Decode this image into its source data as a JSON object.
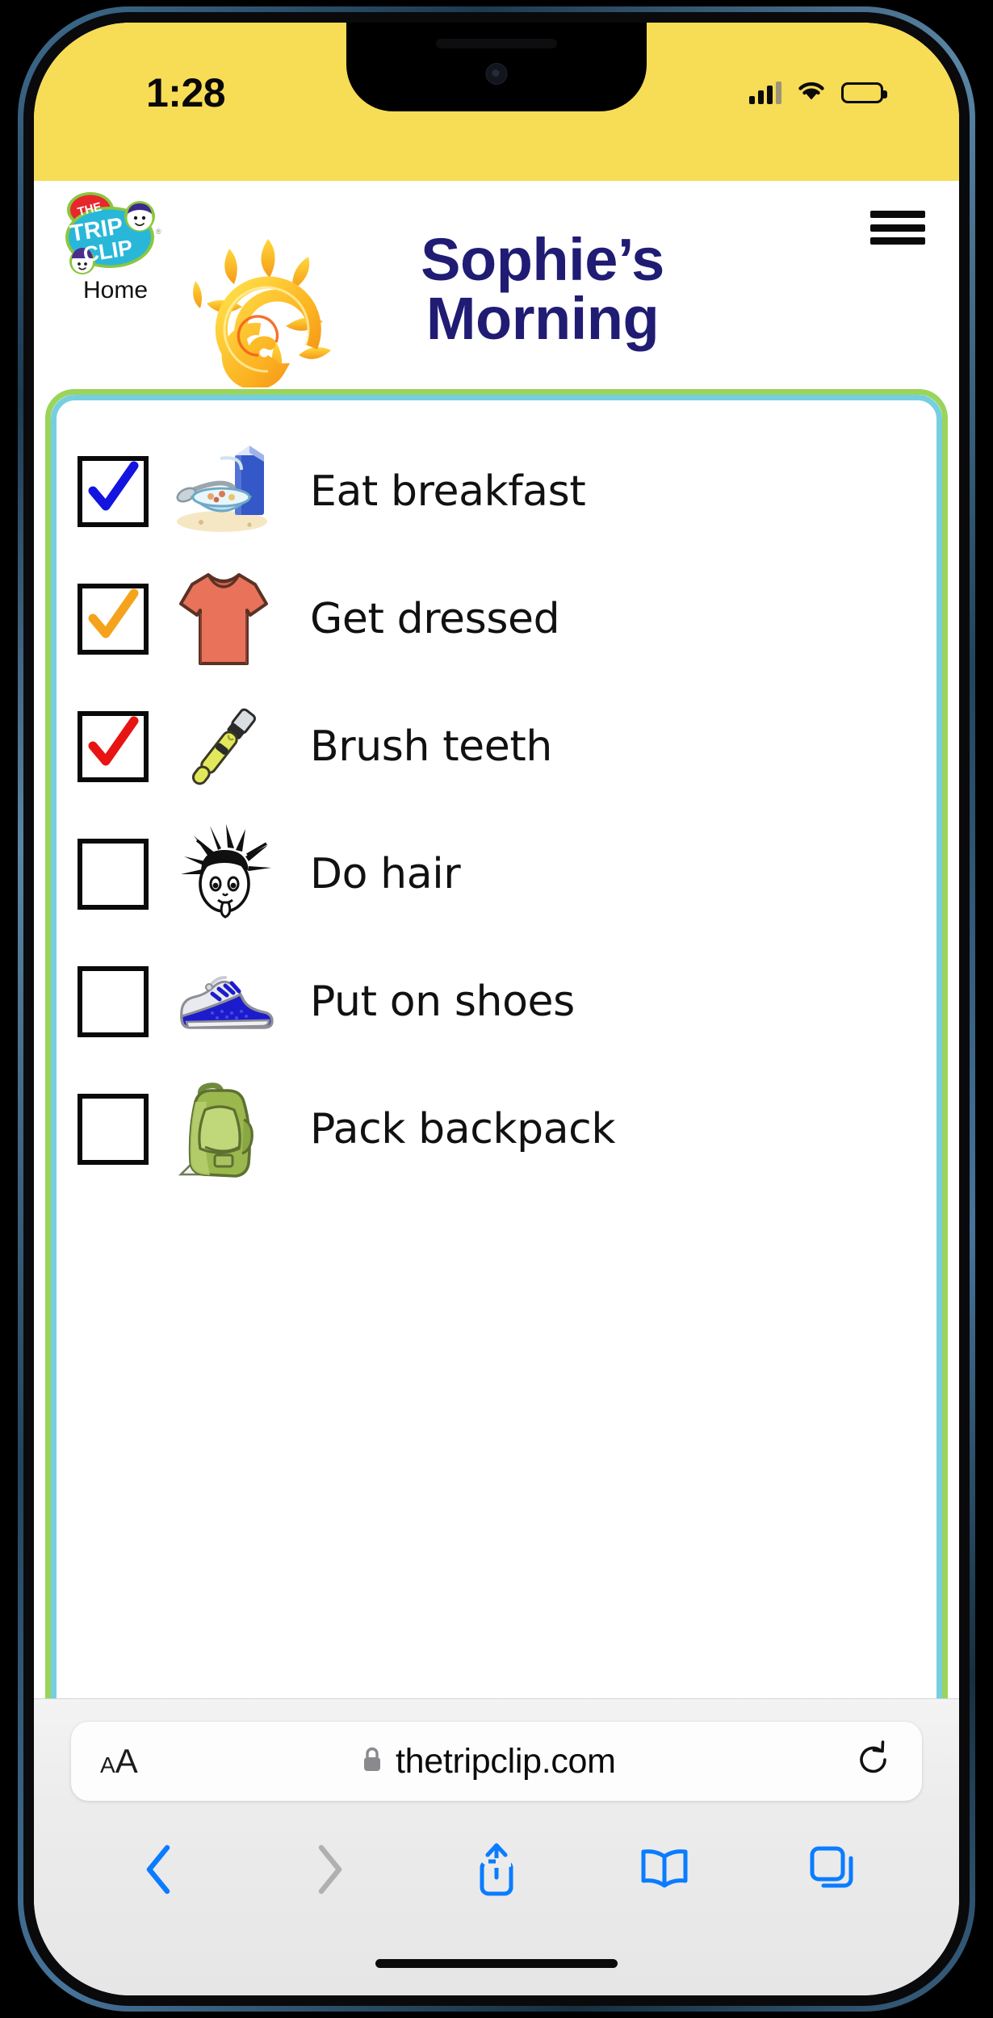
{
  "status_bar": {
    "time": "1:28",
    "cellular_icon": "cellular-signal-icon",
    "wifi_icon": "wifi-icon",
    "battery_icon": "battery-icon",
    "background_color": "#f7dc56"
  },
  "site_header": {
    "logo_alt": "The Trip Clip",
    "logo_text_the": "THE",
    "logo_text_trip": "TRIP",
    "logo_text_clip": "CLIP",
    "home_label": "Home",
    "menu_icon": "hamburger-menu-icon",
    "sun_icon": "sun-illustration",
    "title": "Sophie’s Morning",
    "title_line1": "Sophie’s",
    "title_line2": "Morning",
    "title_color": "#201c74"
  },
  "checklist": {
    "border_outer_color": "#9ad45b",
    "border_inner_color": "#76cfe0",
    "items": [
      {
        "label": "Eat breakfast",
        "checked": true,
        "check_color": "#1414e0",
        "icon": "cereal-bowl-milk-icon"
      },
      {
        "label": "Get dressed",
        "checked": true,
        "check_color": "#f5a31c",
        "icon": "tshirt-icon"
      },
      {
        "label": "Brush teeth",
        "checked": true,
        "check_color": "#e81414",
        "icon": "toothbrush-icon"
      },
      {
        "label": "Do hair",
        "checked": false,
        "check_color": "",
        "icon": "messy-hair-face-icon"
      },
      {
        "label": "Put on shoes",
        "checked": false,
        "check_color": "",
        "icon": "sneaker-icon"
      },
      {
        "label": "Pack backpack",
        "checked": false,
        "check_color": "",
        "icon": "backpack-icon"
      }
    ]
  },
  "browser": {
    "text_size_label_small": "A",
    "text_size_label_big": "A",
    "lock_icon": "lock-icon",
    "url": "thetripclip.com",
    "reload_icon": "reload-icon",
    "back_icon": "chevron-left-icon",
    "forward_icon": "chevron-right-icon",
    "share_icon": "share-icon",
    "bookmarks_icon": "book-icon",
    "tabs_icon": "tabs-icon",
    "accent_color": "#0a7cff",
    "disabled_color": "#b0b0b0"
  }
}
